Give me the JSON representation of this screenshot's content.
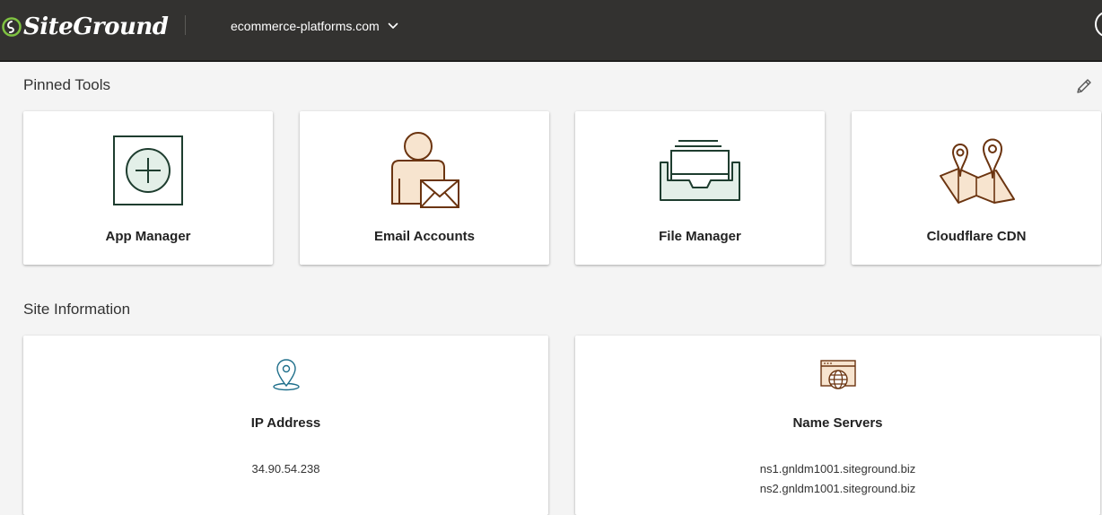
{
  "header": {
    "logo_text": "SiteGround",
    "site_name": "ecommerce-platforms.com",
    "icons": [
      "siteground-logo-icon",
      "chevron-down-icon",
      "user-avatar-icon"
    ]
  },
  "pinned_tools": {
    "title": "Pinned Tools",
    "edit_icon": "pencil-icon",
    "tools": [
      {
        "label": "App Manager",
        "icon": "app-manager-icon"
      },
      {
        "label": "Email Accounts",
        "icon": "email-accounts-icon"
      },
      {
        "label": "File Manager",
        "icon": "file-manager-icon"
      },
      {
        "label": "Cloudflare CDN",
        "icon": "cloudflare-cdn-icon"
      }
    ]
  },
  "site_information": {
    "title": "Site Information",
    "ip_address": {
      "label": "IP Address",
      "value": "34.90.54.238",
      "icon": "location-pin-icon"
    },
    "name_servers": {
      "label": "Name Servers",
      "values": [
        "ns1.gnldm1001.siteground.biz",
        "ns2.gnldm1001.siteground.biz"
      ],
      "icon": "browser-globe-icon"
    }
  },
  "colors": {
    "header_bg": "#333230",
    "page_bg": "#f4f4f4",
    "green_icon": "#1e3d2f",
    "green_fill": "#e3efe8",
    "orange_icon": "#6b3410",
    "orange_fill": "#f7e4cf",
    "teal_icon": "#1f6f8b",
    "brand_green": "#7fc241"
  }
}
